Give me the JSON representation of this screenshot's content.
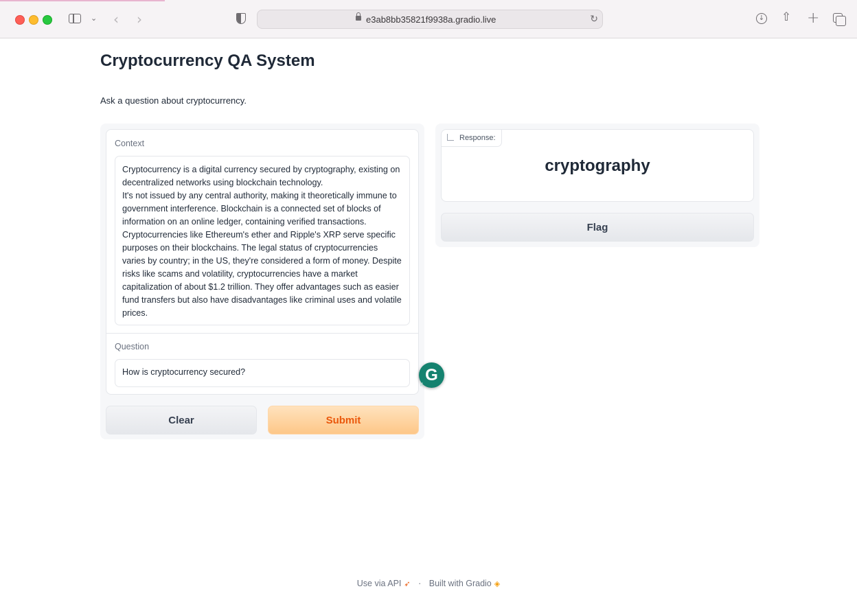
{
  "browser": {
    "url": "e3ab8bb35821f9938a.gradio.live"
  },
  "page": {
    "title": "Cryptocurrency QA System",
    "description": "Ask a question about cryptocurrency."
  },
  "form": {
    "context_label": "Context",
    "context_value": "Cryptocurrency is a digital currency secured by cryptography, existing on decentralized networks using blockchain technology.\nIt's not issued by any central authority, making it theoretically immune to government interference. Blockchain is a connected set of blocks of information on an online ledger, containing verified transactions. Cryptocurrencies like Ethereum's ether and Ripple's XRP serve specific purposes on their blockchains. The legal status of cryptocurrencies varies by country; in the US, they're considered a form of money. Despite risks like scams and volatility, cryptocurrencies have a market capitalization of about $1.2 trillion. They offer advantages such as easier fund transfers but also have disadvantages like criminal uses and volatile prices.",
    "question_label": "Question",
    "question_value": "How is cryptocurrency secured?",
    "clear_label": "Clear",
    "submit_label": "Submit"
  },
  "output": {
    "response_label": "Response:",
    "response_value": "cryptography",
    "flag_label": "Flag"
  },
  "footer": {
    "api_label": "Use via API",
    "separator": "·",
    "built_label": "Built with Gradio"
  },
  "colors": {
    "submit_text": "#ea580c",
    "submit_bg": "#fdc788",
    "grammarly": "#15826f"
  },
  "icons": [
    "sidebar-icon",
    "back-icon",
    "forward-icon",
    "shield-icon",
    "lock-icon",
    "reload-icon",
    "download-icon",
    "share-icon",
    "new-tab-icon",
    "tab-overview-icon",
    "grammarly-icon",
    "label-icon",
    "rocket-icon",
    "gradio-logo-icon"
  ]
}
